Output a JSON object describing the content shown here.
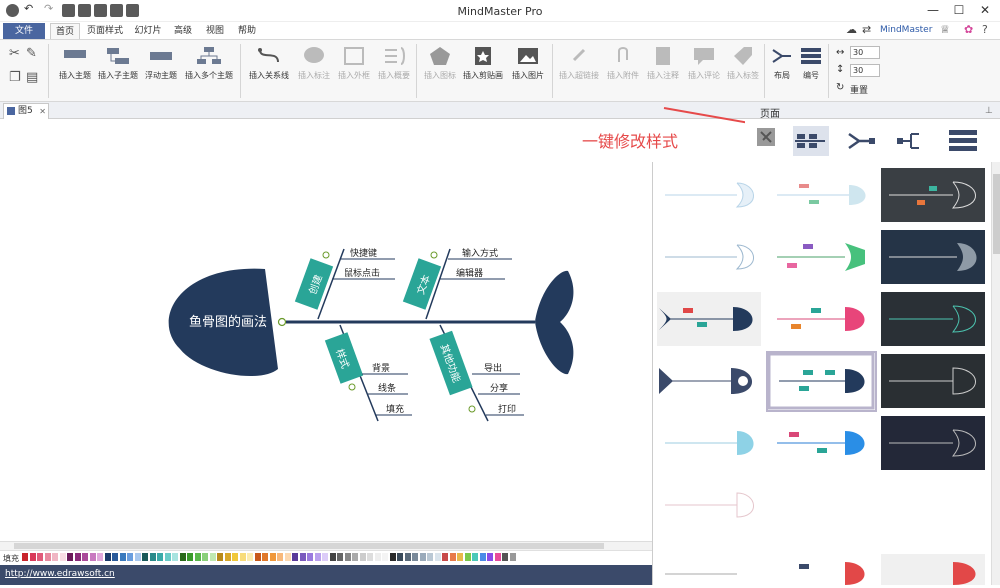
{
  "window": {
    "title": "MindMaster Pro",
    "minimize": "—",
    "maximize": "☐",
    "close": "✕"
  },
  "menu": {
    "file": "文件",
    "tabs": [
      "首页",
      "页面样式",
      "幻灯片",
      "高级",
      "视图",
      "帮助"
    ],
    "user": "MindMaster"
  },
  "ribbon": {
    "buttons": [
      {
        "label": "插入主题"
      },
      {
        "label": "插入子主题"
      },
      {
        "label": "浮动主题"
      },
      {
        "label": "插入多个主题"
      },
      {
        "label": "插入关系线"
      },
      {
        "label": "插入标注"
      },
      {
        "label": "插入外框"
      },
      {
        "label": "插入概要"
      },
      {
        "label": "插入图标"
      },
      {
        "label": "插入剪贴画"
      },
      {
        "label": "插入图片"
      },
      {
        "label": "插入超链接"
      },
      {
        "label": "插入附件"
      },
      {
        "label": "插入注释"
      },
      {
        "label": "插入评论"
      },
      {
        "label": "插入标签"
      },
      {
        "label": "布局"
      },
      {
        "label": "编号"
      }
    ],
    "spin1": "30",
    "spin2": "30",
    "reset": "重置"
  },
  "doc_tab": {
    "name": "图5",
    "close": "✕"
  },
  "panel": {
    "title": "页面",
    "annotation": "一键修改样式"
  },
  "diagram": {
    "head": "鱼骨图的画法",
    "branches": [
      {
        "name": "创建",
        "items": [
          "快捷键",
          "鼠标点击"
        ]
      },
      {
        "name": "文本",
        "items": [
          "输入方式",
          "编辑器"
        ]
      },
      {
        "name": "样式",
        "items": [
          "背景",
          "线条",
          "填充"
        ]
      },
      {
        "name": "其他功能",
        "items": [
          "导出",
          "分享",
          "打印"
        ]
      }
    ]
  },
  "palette": {
    "label": "填充"
  },
  "status": {
    "url": "http://www.edrawsoft.cn"
  },
  "colors": {
    "brand": "#4a66a0",
    "fish": "#233a5c",
    "teal": "#2aa597",
    "annotation": "#e64a4a"
  }
}
